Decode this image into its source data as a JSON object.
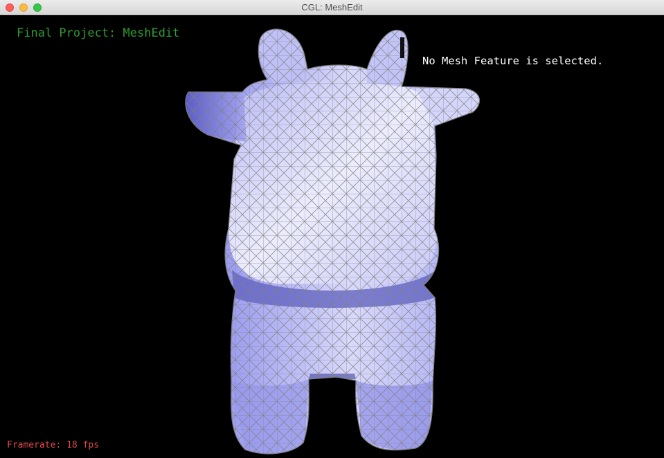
{
  "window": {
    "title": "CGL: MeshEdit"
  },
  "overlay": {
    "project_title": "Final Project: MeshEdit",
    "selection_status": "No Mesh Feature is selected.",
    "framerate": "Framerate: 18 fps"
  },
  "colors": {
    "background": "#000000",
    "mesh_fill": "#a9aaf2",
    "mesh_wire": "#8a8a8a",
    "project_title": "#2f9c2f",
    "status_text": "#ffffff",
    "framerate_text": "#e04a4a"
  },
  "icons": [
    "close-icon",
    "minimize-icon",
    "maximize-icon"
  ]
}
